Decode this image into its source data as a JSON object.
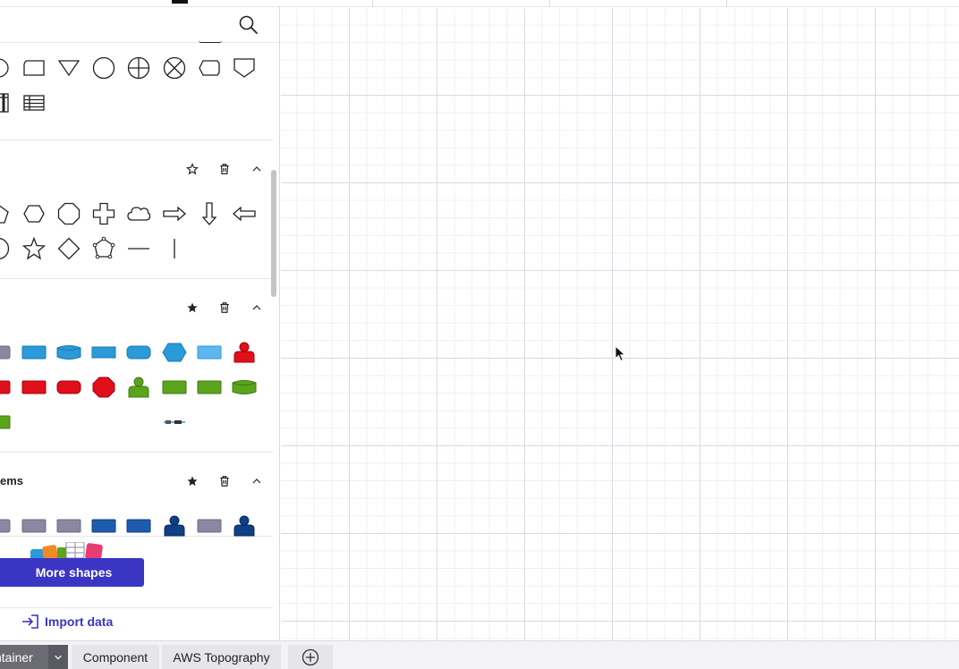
{
  "sidebar": {
    "search": {
      "placeholder": "",
      "value": ""
    },
    "sections": [
      {
        "title": "",
        "shapes": [
          "terminator-icon",
          "punched-tape-icon",
          "merge-icon",
          "circle-icon",
          "summing-junction-icon",
          "or-junction-icon",
          "display-icon",
          "off-page-connector-icon",
          "internal-storage-icon",
          "table-icon"
        ]
      },
      {
        "title": "",
        "shapes": [
          "pentagon-icon",
          "hexagon-icon",
          "octagon-icon",
          "cross-icon",
          "cloud-icon",
          "right-arrow-icon",
          "down-arrow-icon",
          "left-arrow-icon",
          "circle-icon",
          "star-icon",
          "diamond-icon",
          "polygon-icon",
          "horizontal-line-icon",
          "vertical-line-icon"
        ]
      },
      {
        "title": "",
        "shapes": [
          "gray-block-icon",
          "blue-rect-icon",
          "blue-cylinder-icon",
          "blue-rect-icon",
          "blue-rounded-icon",
          "blue-hexagon-icon",
          "light-blue-rect-icon",
          "red-user-icon",
          "red-rect-icon",
          "red-rect-icon",
          "red-rounded-icon",
          "red-octagon-icon",
          "green-user-icon",
          "green-rect-icon",
          "green-rect-icon",
          "green-cylinder-icon",
          "green-rect-icon",
          "connector-icon"
        ]
      },
      {
        "title": "ems",
        "shapes": [
          "gray-block-icon",
          "gray-rect-icon",
          "gray-rect-icon",
          "navy-rect-icon",
          "navy-rect-icon",
          "navy-user-icon",
          "gray-rect-icon",
          "navy-user-icon"
        ]
      }
    ],
    "more_shapes_label": "More shapes",
    "import_label": "Import data"
  },
  "tabs": [
    {
      "label": "ntainer",
      "active": true
    },
    {
      "label": "Component",
      "active": false
    },
    {
      "label": "AWS Topography",
      "active": false
    }
  ],
  "colors": {
    "accent": "#3b35c4",
    "blue": "#2a9ad8",
    "red": "#e0101a",
    "green": "#5aa51c",
    "navy": "#0f3f86",
    "gray": "#8a88a0"
  }
}
